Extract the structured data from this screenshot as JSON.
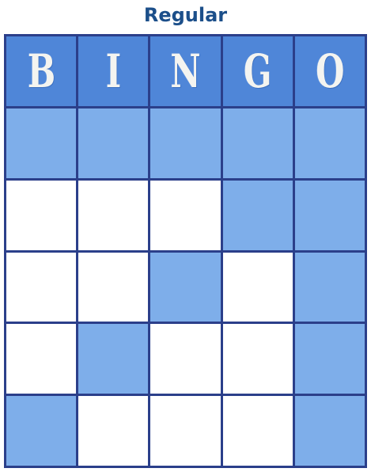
{
  "title": "Regular",
  "header": {
    "letters": [
      "B",
      "I",
      "N",
      "G",
      "O"
    ]
  },
  "pattern": [
    [
      true,
      true,
      true,
      true,
      true
    ],
    [
      false,
      false,
      false,
      true,
      true
    ],
    [
      false,
      false,
      true,
      false,
      true
    ],
    [
      false,
      true,
      false,
      false,
      true
    ],
    [
      true,
      false,
      false,
      false,
      true
    ]
  ],
  "colors": {
    "title": "#1c4f8a",
    "grid_lines": "#2b3f8a",
    "header_background": "#4f86d8",
    "marked_cell": "#7eaeea",
    "unmarked_cell": "#ffffff"
  }
}
